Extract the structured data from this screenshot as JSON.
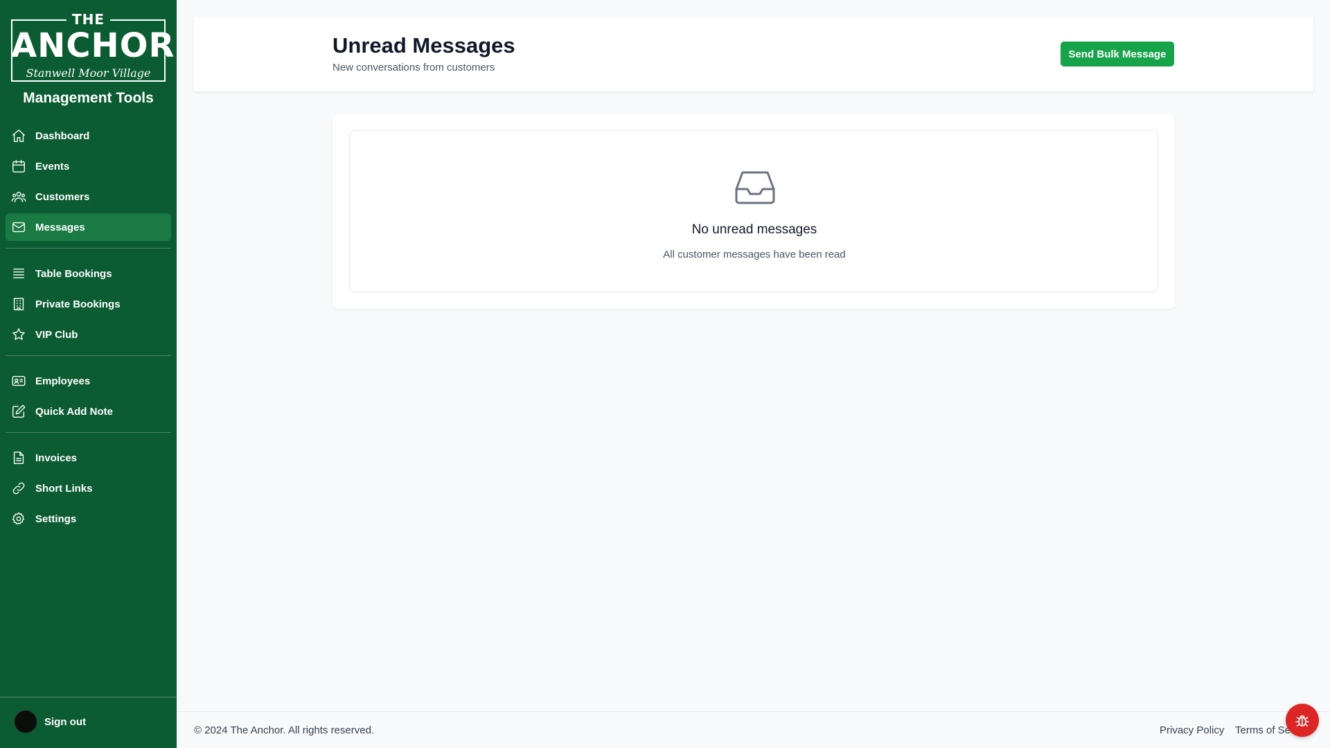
{
  "logo": {
    "the": "THE",
    "anchor": "ANCHOR",
    "script": "Stanwell Moor Village"
  },
  "sidebar": {
    "title": "Management Tools",
    "groups": [
      [
        {
          "label": "Dashboard",
          "icon": "home-icon"
        },
        {
          "label": "Events",
          "icon": "calendar-icon"
        },
        {
          "label": "Customers",
          "icon": "users-icon"
        },
        {
          "label": "Messages",
          "icon": "envelope-icon",
          "active": true
        }
      ],
      [
        {
          "label": "Table Bookings",
          "icon": "list-icon"
        },
        {
          "label": "Private Bookings",
          "icon": "building-icon"
        },
        {
          "label": "VIP Club",
          "icon": "star-icon"
        }
      ],
      [
        {
          "label": "Employees",
          "icon": "id-card-icon"
        },
        {
          "label": "Quick Add Note",
          "icon": "pencil-square-icon"
        }
      ],
      [
        {
          "label": "Invoices",
          "icon": "document-icon"
        },
        {
          "label": "Short Links",
          "icon": "link-icon"
        },
        {
          "label": "Settings",
          "icon": "gear-icon"
        }
      ]
    ],
    "signout_label": "Sign out"
  },
  "header": {
    "title": "Unread Messages",
    "subtitle": "New conversations from customers",
    "bulk_button": "Send Bulk Message"
  },
  "empty_state": {
    "icon": "inbox-icon",
    "title": "No unread messages",
    "subtitle": "All customer messages have been read"
  },
  "footer": {
    "copyright": "© 2024 The Anchor. All rights reserved.",
    "privacy": "Privacy Policy",
    "terms": "Terms of Se"
  },
  "colors": {
    "sidebar_bg": "#0b5c33",
    "active_item": "#1a7a43",
    "primary_button": "#16a34a",
    "fab": "#dc2626"
  }
}
